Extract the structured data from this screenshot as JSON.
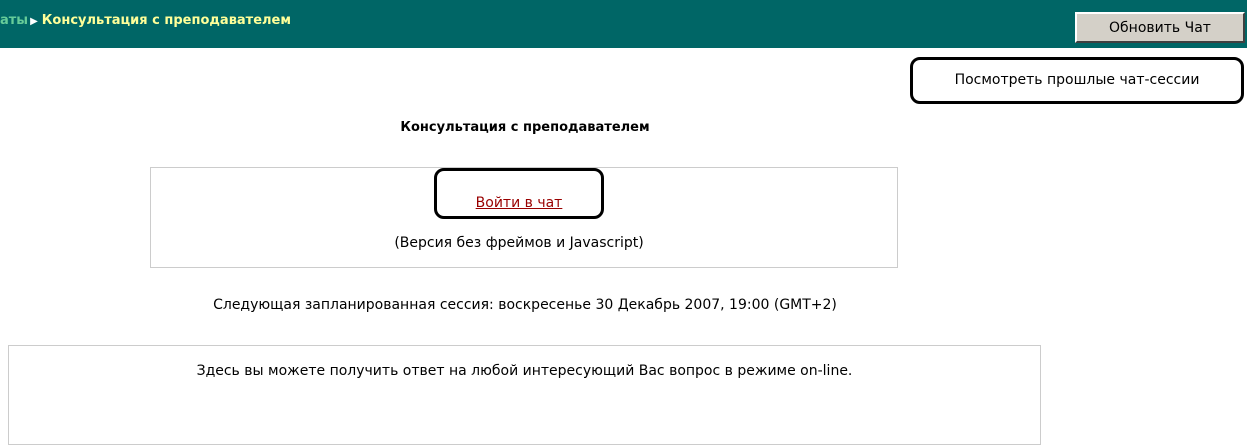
{
  "navbar": {
    "breadcrumb_prev": "аты",
    "breadcrumb_separator": "▶",
    "breadcrumb_current": "Консультация с преподавателем",
    "refresh_button": "Обновить Чат",
    "color": "#006666"
  },
  "links": {
    "past_sessions": "Посмотреть прошлые чат-сессии",
    "enter_chat": "Войти в чат"
  },
  "main": {
    "heading": "Консультация с преподавателем",
    "no_frames_note": "(Версия без фреймов и Javascript)",
    "next_session": "Следующая запланированная сессия: воскресенье 30 Декабрь 2007, 19:00 (GMT+2)",
    "intro": "Здесь вы можете получить ответ на любой интересующий Вас вопрос в режиме on-line."
  }
}
